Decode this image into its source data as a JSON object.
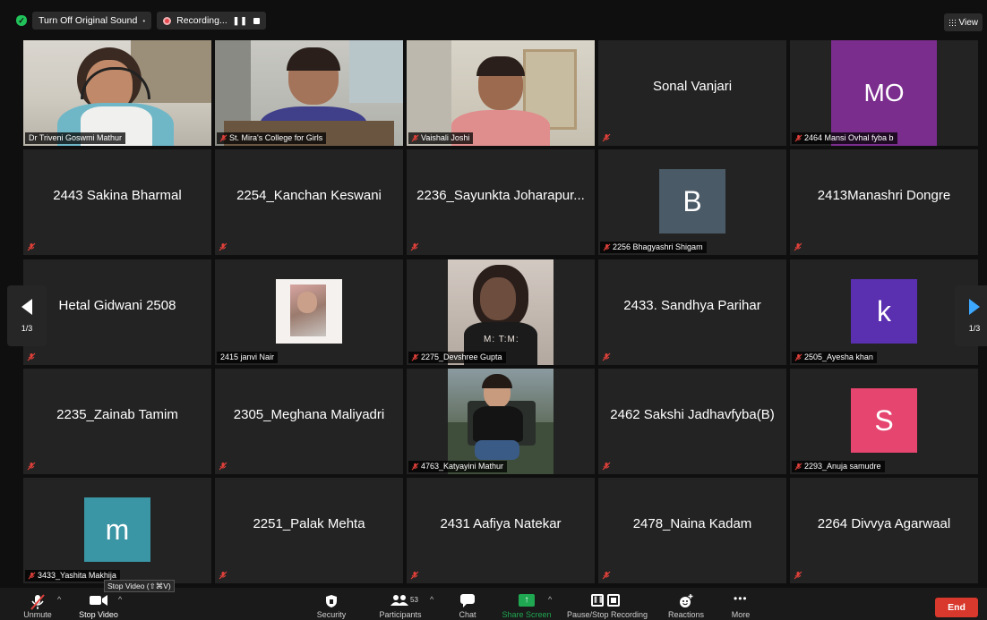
{
  "topbar": {
    "original_sound_label": "Turn Off Original Sound",
    "recording_label": "Recording...",
    "view_label": "View"
  },
  "tiles": [
    {
      "name": "Dr Triveni Goswmi Mathur",
      "mode": "video-tag"
    },
    {
      "name": "St. Mira's College for Girls",
      "mode": "video-tag"
    },
    {
      "name": "Vaishali Joshi",
      "mode": "video-tag"
    },
    {
      "name": "Sonal Vanjari",
      "mode": "center"
    },
    {
      "name": "2464 Mansi Ovhal fyba b",
      "avatar": "MO",
      "avatar_color": "#7b2d8e"
    },
    {
      "name": "2443 Sakina Bharmal",
      "mode": "center"
    },
    {
      "name": "2254_Kanchan Keswani",
      "mode": "center"
    },
    {
      "name": "2236_Sayunkta Joharapur...",
      "mode": "center"
    },
    {
      "name": "2256 Bhagyashri Shigam",
      "avatar": "B",
      "avatar_color": "#4a5a66"
    },
    {
      "name": "2413Manashri Dongre",
      "mode": "center"
    },
    {
      "name": "Hetal Gidwani 2508",
      "mode": "center"
    },
    {
      "name": "2415 janvi Nair",
      "mode": "photo"
    },
    {
      "name": "2275_Devshree Gupta",
      "mode": "photo"
    },
    {
      "name": "2433. Sandhya Parihar",
      "mode": "center"
    },
    {
      "name": "2505_Ayesha khan",
      "avatar": "k",
      "avatar_color": "#5a2fb0"
    },
    {
      "name": "2235_Zainab Tamim",
      "mode": "center"
    },
    {
      "name": "2305_Meghana Maliyadri",
      "mode": "center"
    },
    {
      "name": "4763_Katyayini Mathur",
      "mode": "photo"
    },
    {
      "name": "2462 Sakshi Jadhavfyba(B)",
      "mode": "center"
    },
    {
      "name": "2293_Anuja samudre",
      "avatar": "S",
      "avatar_color": "#e5456f"
    },
    {
      "name": "3433_Yashita Makhija",
      "avatar": "m",
      "avatar_color": "#3a95a4"
    },
    {
      "name": "2251_Palak Mehta",
      "mode": "center"
    },
    {
      "name": "2431 Aafiya Natekar",
      "mode": "center"
    },
    {
      "name": "2478_Naina Kadam",
      "mode": "center"
    },
    {
      "name": "2264 Divvya Agarwaal",
      "mode": "center"
    }
  ],
  "pager": {
    "left_label": "1/3",
    "right_label": "1/3"
  },
  "photo_overlay_text": "M: T:M:",
  "tooltip": "Stop Video (⇧⌘V)",
  "toolbar": {
    "unmute": "Unmute",
    "stop_video": "Stop Video",
    "security": "Security",
    "participants": "Participants",
    "participants_count": "53",
    "chat": "Chat",
    "share_screen": "Share Screen",
    "pause_stop_recording": "Pause/Stop Recording",
    "reactions": "Reactions",
    "more": "More",
    "end": "End"
  },
  "colors": {
    "active_speaker": "#c5e36a",
    "share_green": "#1fa851",
    "end_red": "#d9382c",
    "mute_red": "#e0403a"
  }
}
